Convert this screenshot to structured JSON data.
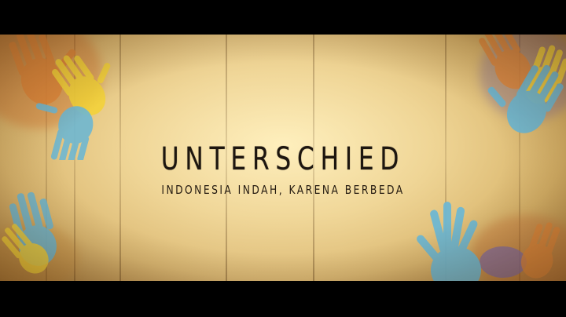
{
  "title": "UNTERSCHIED",
  "subtitle": "INDONESIA INDAH, KARENA BERBEDA",
  "colors": {
    "letterbox": "#000000",
    "paper": "#f1dca6",
    "hand_blue": "#6fb8d2",
    "hand_yellow": "#f3d23a",
    "hand_orange": "#e0873a",
    "hand_purple": "#7c6aa8",
    "text": "#1d160f"
  },
  "decorations": [
    "handprint-icon",
    "paint-splatter"
  ]
}
